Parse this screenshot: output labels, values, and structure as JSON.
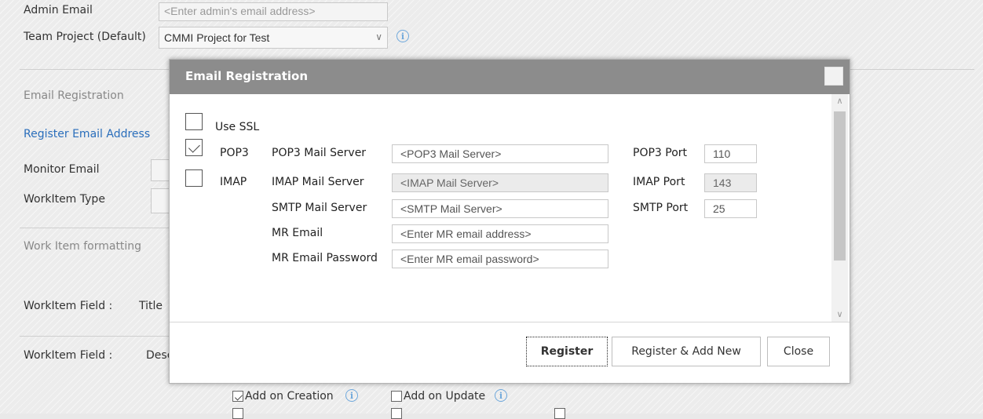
{
  "background": {
    "admin_email_label": "Admin Email",
    "admin_email_placeholder": "<Enter admin's email address>",
    "team_project_label": "Team Project (Default)",
    "team_project_value": "CMMI Project for Test",
    "email_registration_label": "Email Registration",
    "register_email_link": "Register Email Address",
    "monitor_email_label": "Monitor Email",
    "workitem_type_label": "WorkItem Type",
    "work_item_formatting_label": "Work Item formatting",
    "workitem_field_1_label": "WorkItem Field :",
    "workitem_field_1_value": "Title",
    "workitem_field_2_label": "WorkItem Field :",
    "workitem_field_2_value": "Desc",
    "add_on_creation_label": "Add on Creation",
    "add_on_update_label": "Add on Update"
  },
  "modal": {
    "title": "Email Registration",
    "use_ssl": {
      "label": "Use SSL",
      "checked": false
    },
    "pop3": {
      "protocol_label": "POP3",
      "checked": true,
      "server_label": "POP3 Mail Server",
      "server_placeholder": "<POP3 Mail Server>",
      "port_label": "POP3 Port",
      "port_value": "110"
    },
    "imap": {
      "protocol_label": "IMAP",
      "checked": false,
      "server_label": "IMAP Mail Server",
      "server_placeholder": "<IMAP Mail Server>",
      "port_label": "IMAP Port",
      "port_value": "143"
    },
    "smtp": {
      "server_label": "SMTP Mail Server",
      "server_placeholder": "<SMTP Mail Server>",
      "port_label": "SMTP Port",
      "port_value": "25"
    },
    "mr_email": {
      "label": "MR Email",
      "placeholder": "<Enter MR email address>"
    },
    "mr_password": {
      "label": "MR Email Password",
      "placeholder": "<Enter MR email password>"
    },
    "buttons": {
      "register": "Register",
      "register_add_new": "Register & Add New",
      "close": "Close"
    }
  }
}
